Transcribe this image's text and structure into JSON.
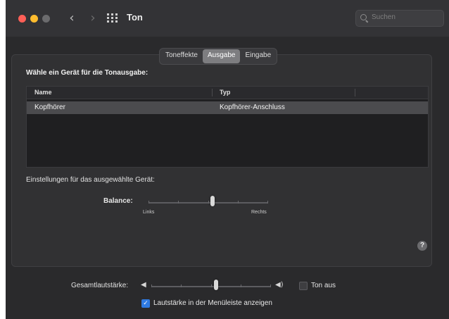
{
  "window": {
    "title": "Ton",
    "search_placeholder": "Suchen"
  },
  "tabs": [
    {
      "label": "Toneffekte",
      "active": false
    },
    {
      "label": "Ausgabe",
      "active": true
    },
    {
      "label": "Eingabe",
      "active": false
    }
  ],
  "output": {
    "heading": "Wähle ein Gerät für die Tonausgabe:",
    "columns": [
      "Name",
      "Typ"
    ],
    "rows": [
      {
        "name": "Kopfhörer",
        "type": "Kopfhörer-Anschluss",
        "selected": true
      }
    ]
  },
  "settings": {
    "heading": "Einstellungen für das ausgewählte Gerät:",
    "balance_label": "Balance:",
    "balance_left": "Links",
    "balance_right": "Rechts",
    "balance_value": 0.5
  },
  "help_label": "?",
  "volume": {
    "label": "Gesamtlautstärke:",
    "value": 0.54,
    "mute_label": "Ton aus",
    "mute_checked": false,
    "menubar_label": "Lautstärke in der Menüleiste anzeigen",
    "menubar_checked": true
  },
  "colors": {
    "accent": "#2f7be3",
    "background": "#2a2a2c"
  },
  "icons": [
    "close-icon",
    "minimize-icon",
    "maximize-icon",
    "back-icon",
    "forward-icon",
    "grid-icon",
    "search-icon",
    "speaker-low-icon",
    "speaker-high-icon",
    "help-icon",
    "checkmark-icon"
  ]
}
